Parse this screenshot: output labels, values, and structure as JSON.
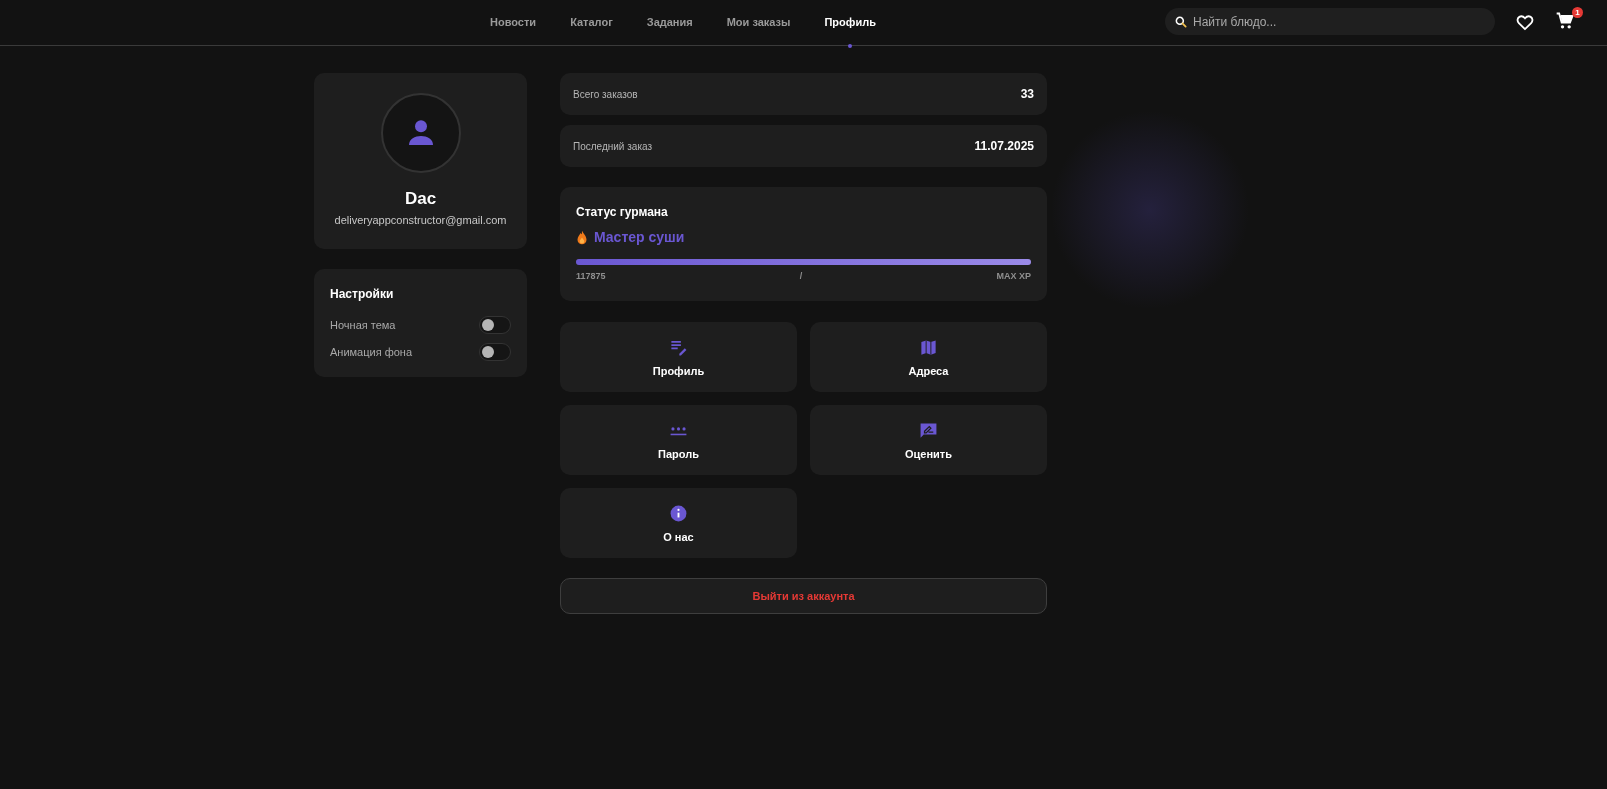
{
  "nav": {
    "items": [
      {
        "label": "Новости",
        "selected": false
      },
      {
        "label": "Каталог",
        "selected": false
      },
      {
        "label": "Задания",
        "selected": false
      },
      {
        "label": "Мои заказы",
        "selected": false
      },
      {
        "label": "Профиль",
        "selected": true
      }
    ],
    "search": {
      "placeholder": "Найти блюдо..."
    },
    "cart_badge": "1"
  },
  "profile": {
    "name": "Dac",
    "email": "deliveryappconstructor@gmail.com"
  },
  "settings": {
    "title": "Настройки",
    "toggles": [
      {
        "label": "Ночная тема",
        "on": false
      },
      {
        "label": "Анимация фона",
        "on": false
      }
    ]
  },
  "stats": [
    {
      "label": "Всего заказов",
      "value": "33"
    },
    {
      "label": "Последний заказ",
      "value": "11.07.2025"
    }
  ],
  "status": {
    "title": "Статус гурмана",
    "rank": "Мастер суши",
    "level": 1,
    "xp": "117875",
    "separator": "/",
    "max": "MAX XP"
  },
  "tiles": [
    {
      "kind": "edit",
      "label": "Профиль"
    },
    {
      "kind": "map",
      "label": "Адреса"
    },
    {
      "kind": "password",
      "label": "Пароль"
    },
    {
      "kind": "rate",
      "label": "Оценить"
    },
    {
      "kind": "info",
      "label": "О нас"
    }
  ],
  "logout": "Выйти из аккаунта"
}
